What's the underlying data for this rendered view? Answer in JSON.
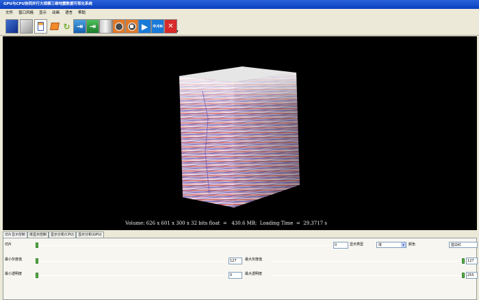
{
  "window": {
    "title": "GPU与CPU协同并行大规模三维地震数据可视化系统"
  },
  "menu": {
    "items": [
      "文件",
      "窗口风格",
      "显示",
      "动画",
      "语言",
      "帮助"
    ]
  },
  "toolbar": {
    "buttons": [
      {
        "icon": "blue-square-icon",
        "label": ""
      },
      {
        "icon": "gray-square-icon",
        "label": ""
      },
      {
        "icon": "document-icon",
        "label": ""
      },
      {
        "icon": "open-folder-icon",
        "label": ""
      },
      {
        "icon": "refresh-arrow-icon",
        "label": ""
      },
      {
        "icon": "import-arrow-icon",
        "label": ""
      },
      {
        "icon": "export-arrow-icon",
        "label": ""
      },
      {
        "icon": "cylinder-icon",
        "label": ""
      },
      {
        "icon": "record-icon",
        "label": ""
      },
      {
        "icon": "stop-icon",
        "label": ""
      },
      {
        "icon": "play-icon",
        "label": ""
      },
      {
        "icon": "language-icon",
        "label": "中/EN"
      },
      {
        "icon": "close-icon",
        "label": "✕"
      }
    ]
  },
  "viewport": {
    "status": "Volume: 626 x 601 x 300 x 32 bits float  =   430.6 MB;  Loading Time  =  29.3717 s"
  },
  "panel": {
    "tabs": [
      "切片显示控制",
      "体显示控制",
      "显示分析(CPU)",
      "显示分析(GPU)"
    ],
    "active_tab": 0,
    "rows": {
      "slice_label": "切片",
      "slice_value": "0",
      "display_type_label": "显示类型",
      "display_type_value": "体",
      "color_label": "颜色",
      "color_value": "蓝白红",
      "min_gray_label": "最小灰度值",
      "min_gray_value": "127",
      "max_gray_label": "最大灰度值",
      "max_gray_value": "127",
      "min_alpha_label": "最小透明度",
      "min_alpha_value": "0",
      "max_alpha_label": "最大透明度",
      "max_alpha_value": "255"
    },
    "sliders": {
      "slice": 0,
      "min_gray": 0,
      "max_gray": 1,
      "min_alpha": 0,
      "max_alpha": 1
    }
  },
  "colors": {
    "accent": "#0a3fc0",
    "seismic_positive": "#c0302c",
    "seismic_negative": "#3b2fa8"
  }
}
